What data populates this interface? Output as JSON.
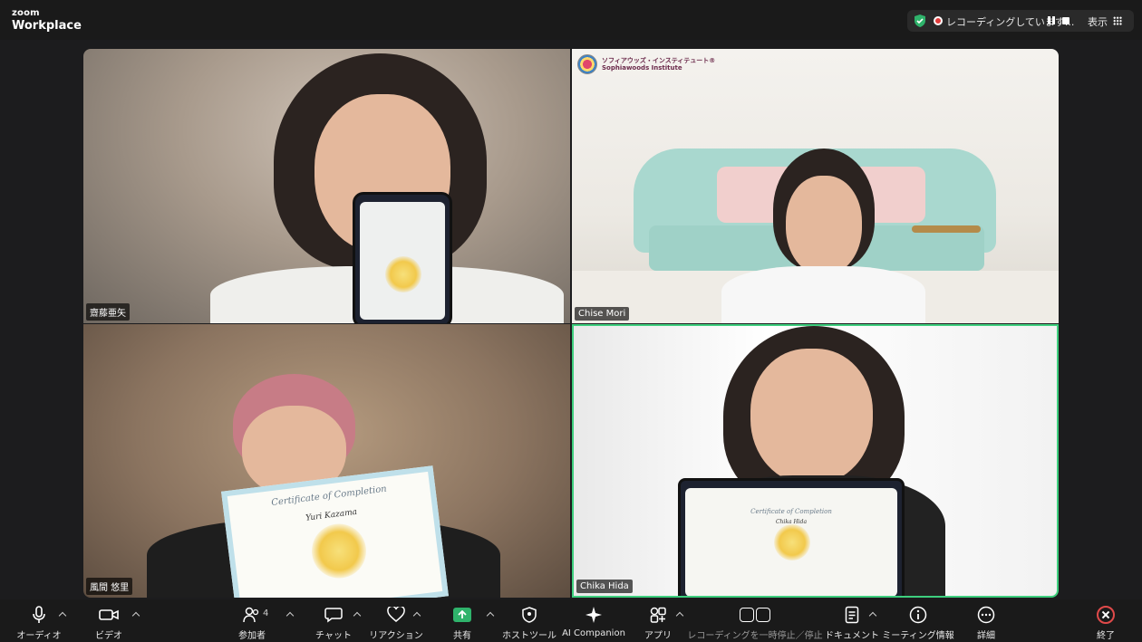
{
  "app": {
    "brand_top": "zoom",
    "brand_bottom": "Workplace"
  },
  "recording": {
    "status": "レコーディングしています...",
    "view_label": "表示"
  },
  "participants": [
    {
      "name": "齋藤亜矢"
    },
    {
      "name": "Chise Mori"
    },
    {
      "name": "風間 悠里"
    },
    {
      "name": "Chika Hida"
    }
  ],
  "virtual_background": {
    "logo_line1": "ソフィアウッズ・インスティテュート®",
    "logo_line2": "Sophiawoods Institute"
  },
  "certificates": {
    "title": "Certificate of Completion",
    "name_left": "Yuri Kazama",
    "name_right": "Chika Hida"
  },
  "toolbar": {
    "audio": "オーディオ",
    "video": "ビデオ",
    "participants": "参加者",
    "participant_count": "4",
    "chat": "チャット",
    "reactions": "リアクション",
    "share": "共有",
    "host_tools": "ホストツール",
    "ai_companion": "AI Companion",
    "apps": "アプリ",
    "recording_pause_stop": "レコーディングを一時停止／停止",
    "docs": "ドキュメント",
    "meeting_info": "ミーティング情報",
    "more": "詳細",
    "end": "終了"
  },
  "colors": {
    "active_speaker_border": "#3ecf7e",
    "share_green": "#2fb36b",
    "end_red": "#e04a4a"
  }
}
